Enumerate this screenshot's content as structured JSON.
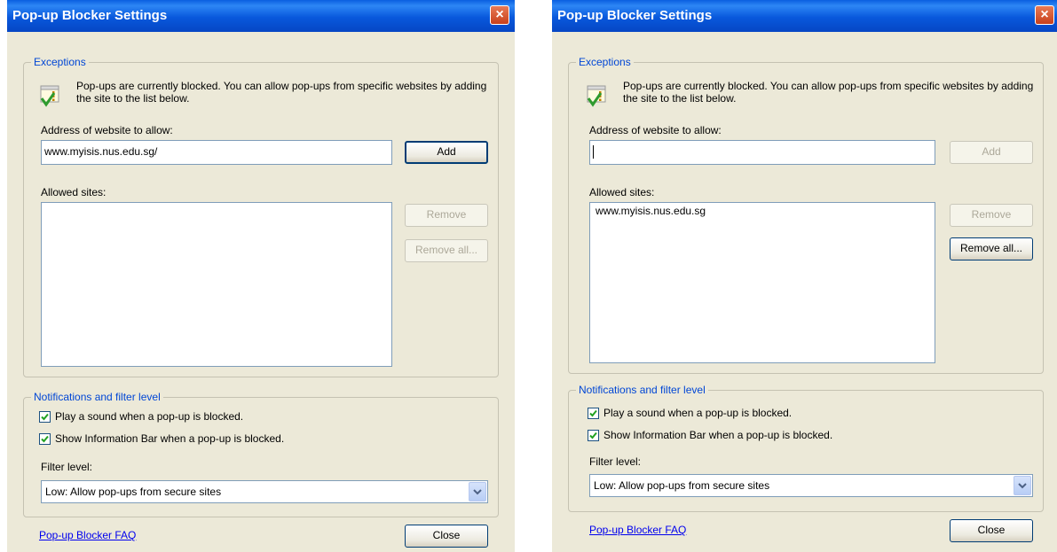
{
  "left_dialog": {
    "title": "Pop-up Blocker Settings",
    "exceptions": {
      "legend": "Exceptions",
      "info_text": "Pop-ups are currently blocked.  You can allow pop-ups from specific websites by adding the site to the list below.",
      "address_label": "Address of website to allow:",
      "address_value": "www.myisis.nus.edu.sg/",
      "add_label": "Add",
      "allowed_label": "Allowed sites:",
      "allowed_sites": [],
      "remove_label": "Remove",
      "remove_all_label": "Remove all..."
    },
    "notifications": {
      "legend": "Notifications and filter level",
      "play_sound_label": "Play a sound when a pop-up is blocked.",
      "play_sound_checked": true,
      "show_info_label": "Show Information Bar when a pop-up is blocked.",
      "show_info_checked": true,
      "filter_label": "Filter level:",
      "filter_value": "Low: Allow pop-ups from secure sites"
    },
    "faq_link": "Pop-up Blocker FAQ",
    "close_label": "Close"
  },
  "right_dialog": {
    "title": "Pop-up Blocker Settings",
    "exceptions": {
      "legend": "Exceptions",
      "info_text": "Pop-ups are currently blocked.  You can allow pop-ups from specific websites by adding the site to the list below.",
      "address_label": "Address of website to allow:",
      "address_value": "",
      "add_label": "Add",
      "allowed_label": "Allowed sites:",
      "allowed_sites": [
        "www.myisis.nus.edu.sg"
      ],
      "remove_label": "Remove",
      "remove_all_label": "Remove all..."
    },
    "notifications": {
      "legend": "Notifications and filter level",
      "play_sound_label": "Play a sound when a pop-up is blocked.",
      "play_sound_checked": true,
      "show_info_label": "Show Information Bar when a pop-up is blocked.",
      "show_info_checked": true,
      "filter_label": "Filter level:",
      "filter_value": "Low: Allow pop-ups from secure sites"
    },
    "faq_link": "Pop-up Blocker FAQ",
    "close_label": "Close"
  },
  "colors": {
    "titlebar": "#0a5fe0",
    "dialog_bg": "#ece9d8",
    "group_legend": "#0046d5",
    "link": "#0000ee",
    "close_button": "#c8401b"
  },
  "icons": {
    "info": "warning-check-icon",
    "close": "close-icon",
    "checkbox": "checkmark-icon",
    "dropdown": "chevron-down-icon"
  }
}
